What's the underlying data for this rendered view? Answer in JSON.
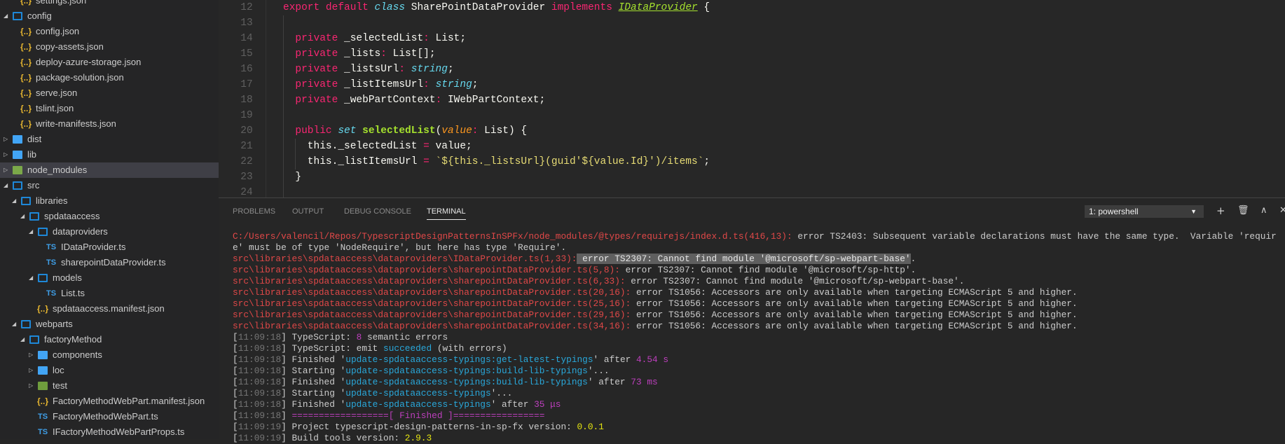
{
  "explorer": {
    "items": [
      {
        "label": "settings.json",
        "type": "json",
        "depth": 1
      },
      {
        "label": "config",
        "type": "folder-open",
        "depth": 0
      },
      {
        "label": "config.json",
        "type": "json",
        "depth": 1
      },
      {
        "label": "copy-assets.json",
        "type": "json",
        "depth": 1
      },
      {
        "label": "deploy-azure-storage.json",
        "type": "json",
        "depth": 1
      },
      {
        "label": "package-solution.json",
        "type": "json",
        "depth": 1
      },
      {
        "label": "serve.json",
        "type": "json",
        "depth": 1
      },
      {
        "label": "tslint.json",
        "type": "json",
        "depth": 1
      },
      {
        "label": "write-manifests.json",
        "type": "json",
        "depth": 1
      },
      {
        "label": "dist",
        "type": "folder",
        "depth": 0
      },
      {
        "label": "lib",
        "type": "folder",
        "depth": 0
      },
      {
        "label": "node_modules",
        "type": "folder-node",
        "depth": 0,
        "selected": true
      },
      {
        "label": "src",
        "type": "folder-open",
        "depth": 0
      },
      {
        "label": "libraries",
        "type": "folder-open",
        "depth": 1
      },
      {
        "label": "spdataaccess",
        "type": "folder-open",
        "depth": 2
      },
      {
        "label": "dataproviders",
        "type": "folder-open",
        "depth": 3
      },
      {
        "label": "IDataProvider.ts",
        "type": "ts",
        "depth": 4
      },
      {
        "label": "sharepointDataProvider.ts",
        "type": "ts",
        "depth": 4
      },
      {
        "label": "models",
        "type": "folder-open",
        "depth": 3
      },
      {
        "label": "List.ts",
        "type": "ts",
        "depth": 4
      },
      {
        "label": "spdataaccess.manifest.json",
        "type": "json",
        "depth": 3
      },
      {
        "label": "webparts",
        "type": "folder-open",
        "depth": 1
      },
      {
        "label": "factoryMethod",
        "type": "folder-open",
        "depth": 2
      },
      {
        "label": "components",
        "type": "folder",
        "depth": 3
      },
      {
        "label": "loc",
        "type": "folder",
        "depth": 3
      },
      {
        "label": "test",
        "type": "folder-test",
        "depth": 3
      },
      {
        "label": "FactoryMethodWebPart.manifest.json",
        "type": "json",
        "depth": 3
      },
      {
        "label": "FactoryMethodWebPart.ts",
        "type": "ts",
        "depth": 3
      },
      {
        "label": "IFactoryMethodWebPartProps.ts",
        "type": "ts",
        "depth": 3
      }
    ]
  },
  "editor": {
    "lines": [
      {
        "n": "12",
        "t": [
          [
            "kw",
            "export default "
          ],
          [
            "st",
            "class"
          ],
          [
            "tx",
            " SharePointDataProvider "
          ],
          [
            "kw",
            "implements"
          ],
          [
            "tx",
            " "
          ],
          [
            "ty",
            "IDataProvider"
          ],
          [
            "tx",
            " {"
          ]
        ]
      },
      {
        "n": "13",
        "t": []
      },
      {
        "n": "14",
        "t": [
          [
            "tx",
            "  "
          ],
          [
            "kw",
            "private"
          ],
          [
            "tx",
            " _selectedList"
          ],
          [
            "kw",
            ":"
          ],
          [
            "tx",
            " List;"
          ]
        ]
      },
      {
        "n": "15",
        "t": [
          [
            "tx",
            "  "
          ],
          [
            "kw",
            "private"
          ],
          [
            "tx",
            " _lists"
          ],
          [
            "kw",
            ":"
          ],
          [
            "tx",
            " List[];"
          ]
        ]
      },
      {
        "n": "16",
        "t": [
          [
            "tx",
            "  "
          ],
          [
            "kw",
            "private"
          ],
          [
            "tx",
            " _listsUrl"
          ],
          [
            "kw",
            ":"
          ],
          [
            "tx",
            " "
          ],
          [
            "st",
            "string"
          ],
          [
            "tx",
            ";"
          ]
        ]
      },
      {
        "n": "17",
        "t": [
          [
            "tx",
            "  "
          ],
          [
            "kw",
            "private"
          ],
          [
            "tx",
            " _listItemsUrl"
          ],
          [
            "kw",
            ":"
          ],
          [
            "tx",
            " "
          ],
          [
            "st",
            "string"
          ],
          [
            "tx",
            ";"
          ]
        ]
      },
      {
        "n": "18",
        "t": [
          [
            "tx",
            "  "
          ],
          [
            "kw",
            "private"
          ],
          [
            "tx",
            " _webPartContext"
          ],
          [
            "kw",
            ":"
          ],
          [
            "tx",
            " IWebPartContext;"
          ]
        ]
      },
      {
        "n": "19",
        "t": []
      },
      {
        "n": "20",
        "t": [
          [
            "tx",
            "  "
          ],
          [
            "kw",
            "public"
          ],
          [
            "tx",
            " "
          ],
          [
            "st",
            "set"
          ],
          [
            "tx",
            " "
          ],
          [
            "fn",
            "selectedList"
          ],
          [
            "tx",
            "("
          ],
          [
            "pa",
            "value"
          ],
          [
            "kw",
            ":"
          ],
          [
            "tx",
            " List) {"
          ]
        ]
      },
      {
        "n": "21",
        "t": [
          [
            "tx",
            "    this._selectedList "
          ],
          [
            "kw",
            "="
          ],
          [
            "tx",
            " value;"
          ]
        ]
      },
      {
        "n": "22",
        "t": [
          [
            "tx",
            "    this._listItemsUrl "
          ],
          [
            "kw",
            "="
          ],
          [
            "tx",
            " "
          ],
          [
            "str",
            "`${this._listsUrl}(guid'${value.Id}')/items`"
          ],
          [
            "tx",
            ";"
          ]
        ]
      },
      {
        "n": "23",
        "t": [
          [
            "tx",
            "  }"
          ]
        ]
      },
      {
        "n": "24",
        "t": []
      }
    ]
  },
  "panel": {
    "tabs": [
      "PROBLEMS",
      "OUTPUT",
      "DEBUG CONSOLE",
      "TERMINAL"
    ],
    "active_tab": 3,
    "terminal_select": "1: powershell",
    "terminal": [
      [
        [
          "r",
          "C:/Users/valencil/Repos/TypescriptDesignPatternsInSPFx/node_modules/@types/requirejs/index.d.ts(416,13):"
        ],
        [
          "w",
          " error TS2403: Subsequent variable declarations must have the same type.  Variable 'requir"
        ]
      ],
      [
        [
          "w",
          "e' must be of type 'NodeRequire', but here has type 'Require'."
        ]
      ],
      [
        [
          "r",
          "src\\libraries\\spdataaccess\\dataproviders\\IDataProvider.ts(1,33):"
        ],
        [
          "hl",
          " error TS2307: Cannot find module '@microsoft/sp-webpart-base'"
        ],
        [
          "w",
          "."
        ]
      ],
      [
        [
          "r",
          "src\\libraries\\spdataaccess\\dataproviders\\sharepointDataProvider.ts(5,8):"
        ],
        [
          "w",
          " error TS2307: Cannot find module '@microsoft/sp-http'."
        ]
      ],
      [
        [
          "r",
          "src\\libraries\\spdataaccess\\dataproviders\\sharepointDataProvider.ts(6,33):"
        ],
        [
          "w",
          " error TS2307: Cannot find module '@microsoft/sp-webpart-base'."
        ]
      ],
      [
        [
          "r",
          "src\\libraries\\spdataaccess\\dataproviders\\sharepointDataProvider.ts(20,16):"
        ],
        [
          "w",
          " error TS1056: Accessors are only available when targeting ECMAScript 5 and higher."
        ]
      ],
      [
        [
          "r",
          "src\\libraries\\spdataaccess\\dataproviders\\sharepointDataProvider.ts(25,16):"
        ],
        [
          "w",
          " error TS1056: Accessors are only available when targeting ECMAScript 5 and higher."
        ]
      ],
      [
        [
          "r",
          "src\\libraries\\spdataaccess\\dataproviders\\sharepointDataProvider.ts(29,16):"
        ],
        [
          "w",
          " error TS1056: Accessors are only available when targeting ECMAScript 5 and higher."
        ]
      ],
      [
        [
          "r",
          "src\\libraries\\spdataaccess\\dataproviders\\sharepointDataProvider.ts(34,16):"
        ],
        [
          "w",
          " error TS1056: Accessors are only available when targeting ECMAScript 5 and higher."
        ]
      ],
      [
        [
          "w",
          "["
        ],
        [
          "g",
          "11:09:18"
        ],
        [
          "w",
          "] TypeScript: "
        ],
        [
          "m",
          "8"
        ],
        [
          "w",
          " semantic errors"
        ]
      ],
      [
        [
          "w",
          "["
        ],
        [
          "g",
          "11:09:18"
        ],
        [
          "w",
          "] TypeScript: emit "
        ],
        [
          "c",
          "succeeded"
        ],
        [
          "w",
          " (with errors)"
        ]
      ],
      [
        [
          "w",
          "["
        ],
        [
          "g",
          "11:09:18"
        ],
        [
          "w",
          "] Finished '"
        ],
        [
          "c",
          "update-spdataaccess-typings:get-latest-typings"
        ],
        [
          "w",
          "' after "
        ],
        [
          "m",
          "4.54 s"
        ]
      ],
      [
        [
          "w",
          "["
        ],
        [
          "g",
          "11:09:18"
        ],
        [
          "w",
          "] Starting '"
        ],
        [
          "c",
          "update-spdataaccess-typings:build-lib-typings"
        ],
        [
          "w",
          "'..."
        ]
      ],
      [
        [
          "w",
          "["
        ],
        [
          "g",
          "11:09:18"
        ],
        [
          "w",
          "] Finished '"
        ],
        [
          "c",
          "update-spdataaccess-typings:build-lib-typings"
        ],
        [
          "w",
          "' after "
        ],
        [
          "m",
          "73 ms"
        ]
      ],
      [
        [
          "w",
          "["
        ],
        [
          "g",
          "11:09:18"
        ],
        [
          "w",
          "] Starting '"
        ],
        [
          "c",
          "update-spdataaccess-typings"
        ],
        [
          "w",
          "'..."
        ]
      ],
      [
        [
          "w",
          "["
        ],
        [
          "g",
          "11:09:18"
        ],
        [
          "w",
          "] Finished '"
        ],
        [
          "c",
          "update-spdataaccess-typings"
        ],
        [
          "w",
          "' after "
        ],
        [
          "m",
          "35 μs"
        ]
      ],
      [
        [
          "w",
          "["
        ],
        [
          "g",
          "11:09:18"
        ],
        [
          "w",
          "] "
        ],
        [
          "m",
          "==================[ Finished ]================="
        ]
      ],
      [
        [
          "w",
          "["
        ],
        [
          "g",
          "11:09:19"
        ],
        [
          "w",
          "] Project typescript-design-patterns-in-sp-fx version: "
        ],
        [
          "y",
          "0.0.1"
        ]
      ],
      [
        [
          "w",
          "["
        ],
        [
          "g",
          "11:09:19"
        ],
        [
          "w",
          "] Build tools version: "
        ],
        [
          "y",
          "2.9.3"
        ]
      ]
    ]
  },
  "colors": {
    "keyword": "#f92672",
    "type": "#66d9ef",
    "function": "#a6e22e",
    "error": "#e04848",
    "selection": "#3f3f46"
  }
}
